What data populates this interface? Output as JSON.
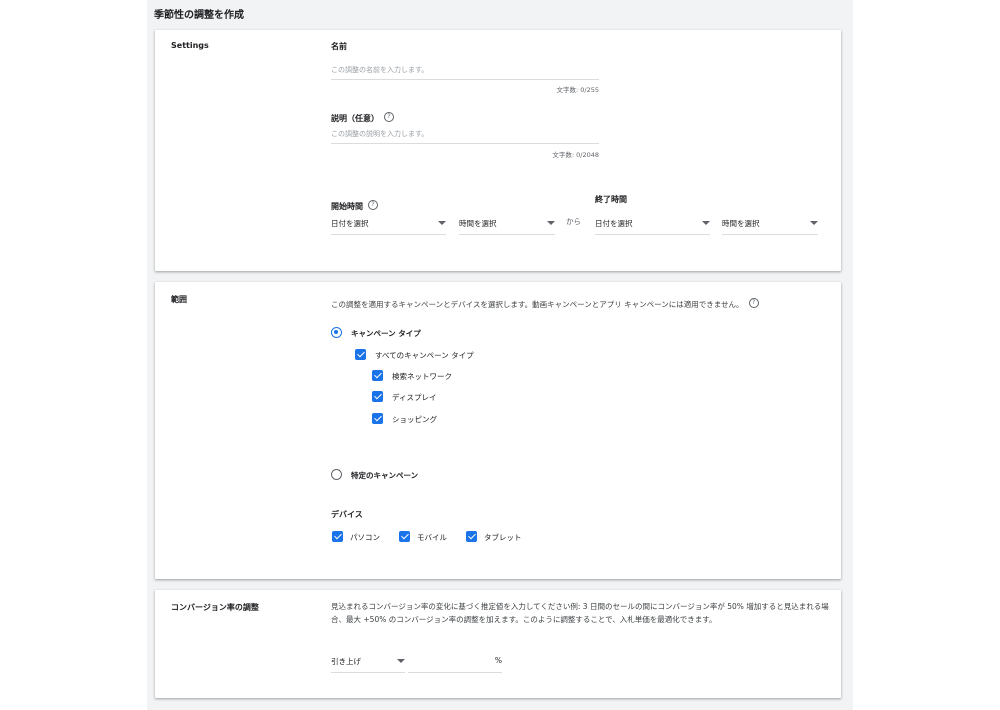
{
  "page": {
    "title": "季節性の調整を作成"
  },
  "settings": {
    "section_label": "Settings",
    "name": {
      "label": "名前",
      "placeholder": "この調整の名前を入力します。",
      "counter": "文字数: 0/255"
    },
    "description": {
      "label": "説明（任意）",
      "placeholder": "この調整の説明を入力します。",
      "counter": "文字数: 0/2048"
    },
    "start": {
      "label": "開始時間",
      "date": "日付を選択",
      "time": "時間を選択"
    },
    "range_sep": "から",
    "end": {
      "label": "終了時間",
      "date": "日付を選択",
      "time": "時間を選択"
    },
    "help_icon": "help-icon"
  },
  "scope": {
    "section_label": "範囲",
    "description": "この調整を適用するキャンペーンとデバイスを選択します。動画キャンペーンとアプリ キャンペーンには適用できません。",
    "campaign_type": {
      "label": "キャンペーン タイプ",
      "selected": true
    },
    "all_types": {
      "label": "すべてのキャンペーン タイプ",
      "checked": true
    },
    "types": [
      {
        "label": "検索ネットワーク",
        "checked": true
      },
      {
        "label": "ディスプレイ",
        "checked": true
      },
      {
        "label": "ショッピング",
        "checked": true
      }
    ],
    "specific_campaigns": {
      "label": "特定のキャンペーン",
      "selected": false
    },
    "devices": {
      "label": "デバイス",
      "items": [
        {
          "label": "パソコン",
          "checked": true
        },
        {
          "label": "モバイル",
          "checked": true
        },
        {
          "label": "タブレット",
          "checked": true
        }
      ]
    }
  },
  "conversion": {
    "section_label": "コンバージョン率の調整",
    "description": "見込まれるコンバージョン率の変化に基づく推定値を入力してください例: 3 日間のセールの間にコンバージョン率が 50% 増加すると見込まれる場合、最大 +50% のコンバージョン率の調整を加えます。このように調整することで、入札単価を最適化できます。",
    "direction": "引き上げ",
    "percent_unit": "%"
  },
  "colors": {
    "accent": "#1a73e8",
    "page_bg": "#f1f3f4"
  }
}
